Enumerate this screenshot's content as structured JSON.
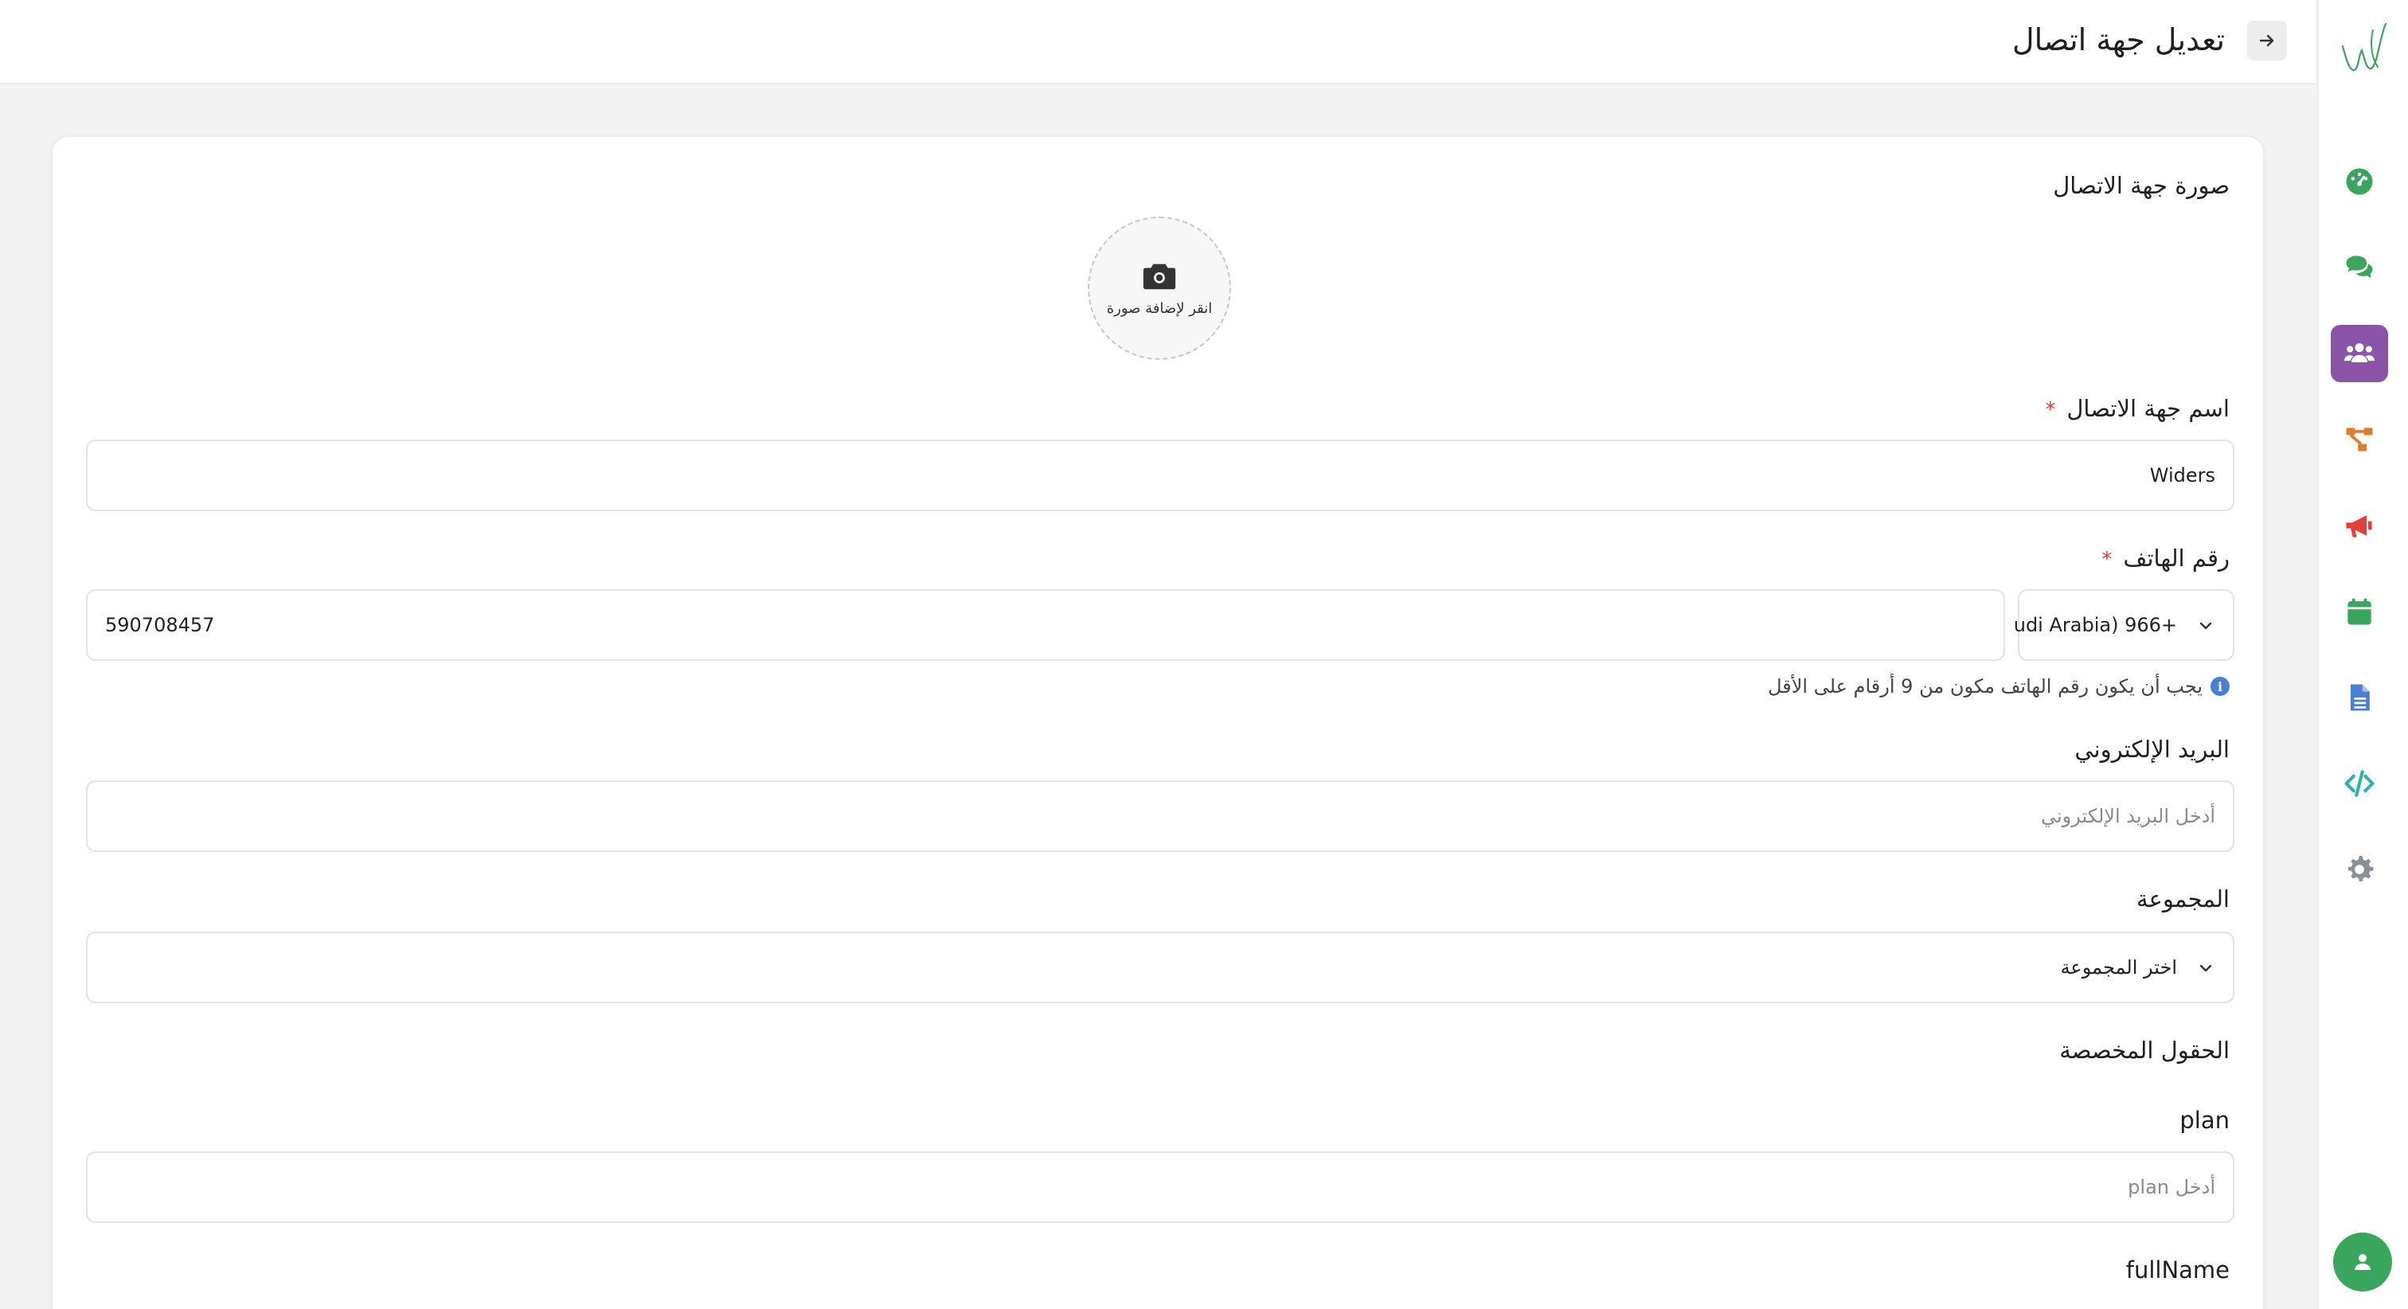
{
  "header": {
    "title": "تعديل جهة اتصال",
    "back_icon": "arrow-right-icon"
  },
  "sidebar": {
    "logo": "wideric-logo",
    "items": [
      {
        "name": "dashboard",
        "icon": "gauge-icon",
        "color": "#3aa55d",
        "active": false
      },
      {
        "name": "chats",
        "icon": "comments-icon",
        "color": "#3aa55d",
        "active": false
      },
      {
        "name": "contacts",
        "icon": "users-icon",
        "color": "#ffffff",
        "active": true
      },
      {
        "name": "flows",
        "icon": "sitemap-icon",
        "color": "#e07b2a",
        "active": false
      },
      {
        "name": "campaigns",
        "icon": "megaphone-icon",
        "color": "#e0403b",
        "active": false
      },
      {
        "name": "calendar",
        "icon": "calendar-icon",
        "color": "#3aa55d",
        "active": false
      },
      {
        "name": "templates",
        "icon": "document-icon",
        "color": "#4a7fd4",
        "active": false
      },
      {
        "name": "api",
        "icon": "code-icon",
        "color": "#2bb3a3",
        "active": false
      },
      {
        "name": "settings",
        "icon": "gear-icon",
        "color": "#8a8f96",
        "active": false
      }
    ],
    "profile_icon": "user-icon"
  },
  "form": {
    "photo_label": "صورة جهة الاتصال",
    "photo_upload_text": "انقر لإضافة صورة",
    "name_label": "اسم جهة الاتصال",
    "name_required": "*",
    "name_value": "Widers",
    "phone_label": "رقم الهاتف",
    "phone_required": "*",
    "phone_value": "590708457",
    "country_code_value": "udi Arabia) 966+",
    "phone_hint": "يجب أن يكون رقم الهاتف مكون من 9 أرقام على الأقل",
    "email_label": "البريد الإلكتروني",
    "email_placeholder": "أدخل البريد الإلكتروني",
    "group_label": "المجموعة",
    "group_placeholder": "اختر المجموعة",
    "custom_fields_label": "الحقول المخصصة",
    "plan_label": "plan",
    "plan_placeholder": "أدخل plan",
    "fullname_label": "fullName"
  },
  "colors": {
    "accent_purple": "#8a55a8",
    "brand_green": "#3aa55d",
    "required_red": "#e0403b",
    "info_blue": "#4a7fd4"
  }
}
